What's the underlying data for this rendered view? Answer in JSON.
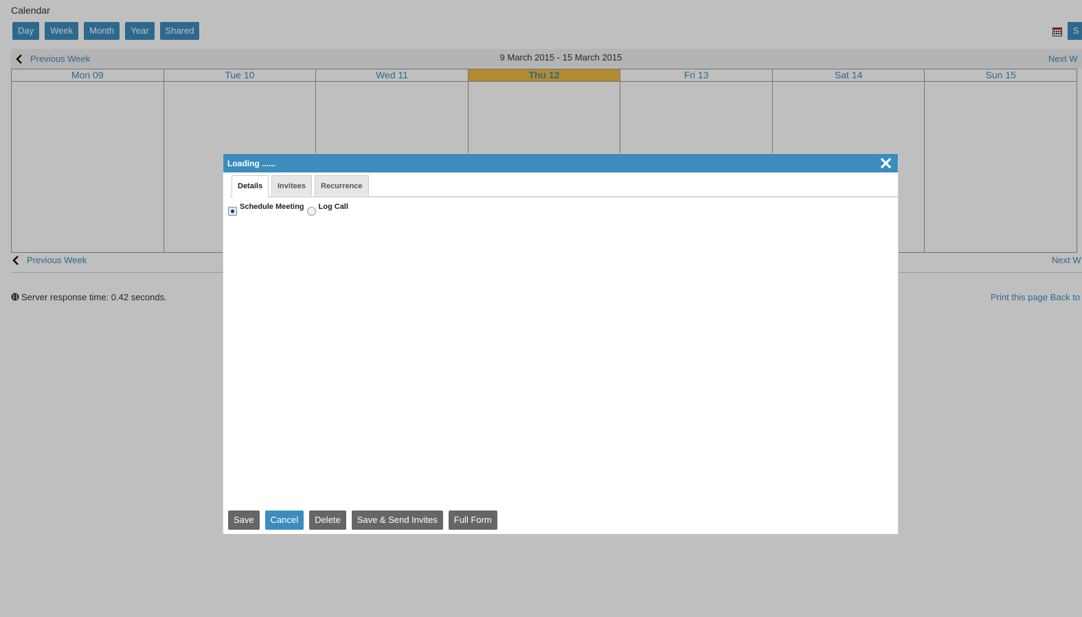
{
  "calendar": {
    "title": "Calendar",
    "views": [
      "Day",
      "Week",
      "Month",
      "Year",
      "Shared"
    ],
    "top_right_button": "S",
    "week_range": "9 March 2015 - 15 March 2015",
    "prev_week": "Previous Week",
    "next_week": "Next W",
    "days": [
      {
        "label": "Mon 09",
        "today": false
      },
      {
        "label": "Tue 10",
        "today": false
      },
      {
        "label": "Wed 11",
        "today": false
      },
      {
        "label": "Thu 12",
        "today": true
      },
      {
        "label": "Fri 13",
        "today": false
      },
      {
        "label": "Sat 14",
        "today": false
      },
      {
        "label": "Sun 15",
        "today": false
      }
    ],
    "today_color": "#f0b840"
  },
  "footer": {
    "server_response": "Server response time: 0.42 seconds.",
    "print_page": "Print this page",
    "back_to": "Back to"
  },
  "dialog": {
    "title": "Loading ......",
    "tabs": [
      "Details",
      "Invitees",
      "Recurrence"
    ],
    "active_tab": "Details",
    "options": [
      {
        "label": "Schedule Meeting",
        "checked": true
      },
      {
        "label": "Log Call",
        "checked": false
      }
    ],
    "buttons": {
      "save": "Save",
      "cancel": "Cancel",
      "delete": "Delete",
      "save_send": "Save & Send Invites",
      "full_form": "Full Form"
    }
  },
  "colors": {
    "accent": "#3c8dbc",
    "button_gray": "#666666"
  },
  "icons": {
    "close": "close-icon",
    "calendar_picker": "calendar-icon",
    "chevron_left": "chevron-left-icon",
    "globe": "globe-icon"
  }
}
